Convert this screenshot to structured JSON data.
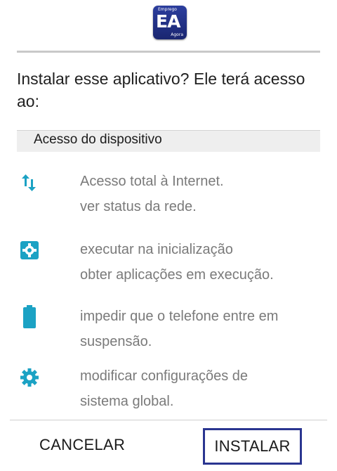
{
  "app_icon": {
    "top_text": "Emprego",
    "main_text": "EA",
    "bottom_text": "Agora"
  },
  "title": "Instalar esse aplicativo? Ele terá acesso ao:",
  "section_header": "Acesso do dispositivo",
  "permissions": [
    {
      "icon": "network-arrows-icon",
      "lines": [
        "Acesso total à Internet.",
        "ver status da rede."
      ]
    },
    {
      "icon": "startup-gear-square-icon",
      "lines": [
        "executar na inicialização",
        "obter aplicações em execução."
      ]
    },
    {
      "icon": "battery-icon",
      "lines": [
        "impedir que o telefone entre em",
        "suspensão."
      ]
    },
    {
      "icon": "settings-gear-icon",
      "lines": [
        "modificar configurações de",
        "sistema global."
      ]
    }
  ],
  "buttons": {
    "cancel": "CANCELAR",
    "install": "INSTALAR"
  },
  "colors": {
    "accent": "#1ba2c4",
    "highlight_border": "#2a3590",
    "app_icon_bg": "#1f2b80"
  }
}
